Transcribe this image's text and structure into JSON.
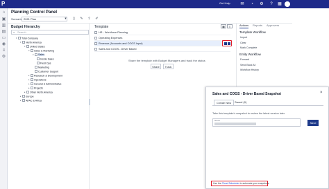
{
  "topbar": {
    "help_label": "Get Help"
  },
  "page": {
    "title": "Planning Control Panel",
    "scenario_label": "Scenario:",
    "scenario_value": "2021 Plan"
  },
  "budget": {
    "heading": "Budget Hierarchy",
    "search_placeholder": "Search",
    "tree": [
      "Total Company",
      "North America",
      "United States",
      "Sales & Marketing",
      "Sales",
      "Inside Sales",
      "Field Ops",
      "Marketing",
      "Customer Support",
      "Research & Development",
      "Operations",
      "General & Administrative",
      "Projects",
      "Other North America",
      "Europe",
      "APAC & Africa"
    ]
  },
  "template": {
    "heading": "Template",
    "rows": [
      "HR - Workforce Planning",
      "Operating Expenses",
      "Revenue (Accounts and COGS Input)",
      "Sales and COGS - Driver Based"
    ],
    "share_text": "Share the template with Budget Managers and track the status",
    "share_label": "Share",
    "track_label": "Track"
  },
  "right_panel": {
    "tabs": [
      "Actions",
      "Reports",
      "Approvers"
    ],
    "template_workflow_heading": "Template Workflow",
    "template_workflow_items": [
      "Import",
      "Clear",
      "Mark Complete"
    ],
    "entity_workflow_heading": "Entity Workflow",
    "entity_workflow_items": [
      "Forward",
      "Send Back All",
      "Workflow History"
    ]
  },
  "snapshot_panel": {
    "title": "Sales and COGS - Driver Based Snapshot",
    "close_glyph": "×",
    "tabs": [
      "Create New",
      "Saved (0)"
    ],
    "description": "Take this template's snapshot to review the latest version later",
    "name_field_label": "Name",
    "save_label": "Save",
    "schedule_prefix": "Use the",
    "schedule_link": "Cloud Scheduler",
    "schedule_suffix": "to automate your snapshots"
  }
}
